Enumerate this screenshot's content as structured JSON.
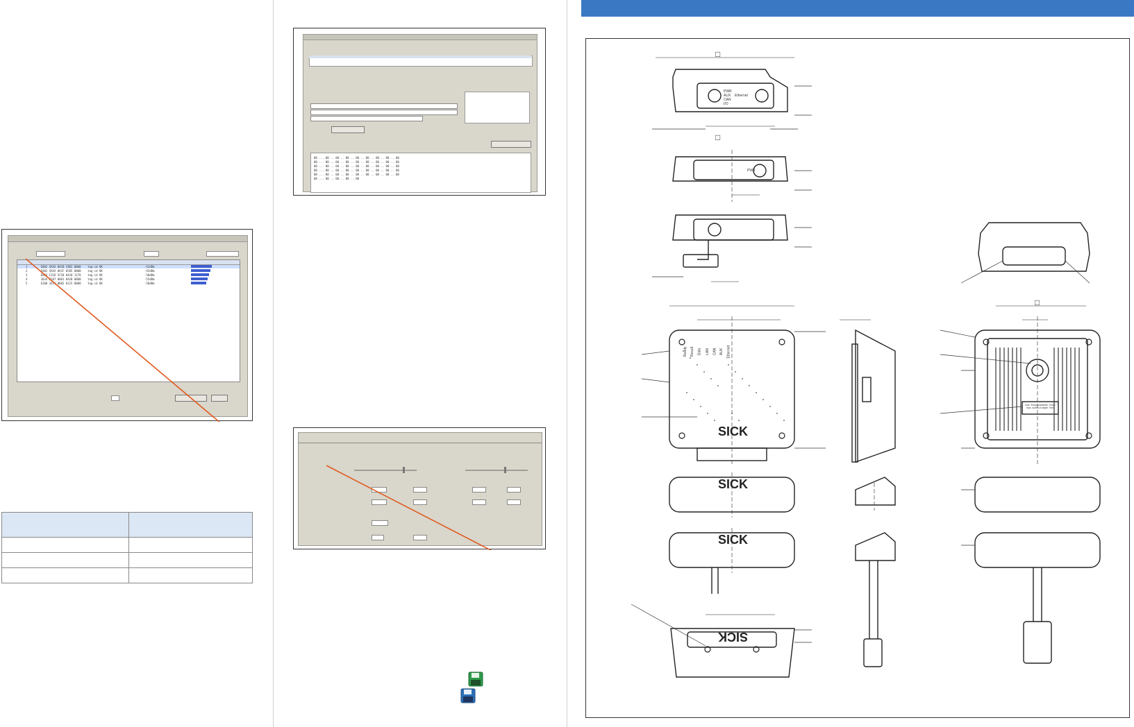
{
  "colors": {
    "accent_bar": "#3a78c4",
    "callout_line": "#e05a1f",
    "table_header": "#dce7f5",
    "save_icon_green": "#2e9b4a",
    "save_icon_blue": "#2b6fb6"
  },
  "logo": {
    "text": "SICK"
  },
  "drawing": {
    "symbol": "□",
    "front_labels": [
      "PWR",
      "AUX",
      "CAN",
      "I/O"
    ],
    "front_label_right": "Ethernet",
    "side_label": "PWR",
    "led_labels": [
      "Ready",
      "Result",
      "Data",
      "LAN",
      "CAN",
      "AUX",
      "Ethernet"
    ],
    "back_label": "max. Einschraubtiefe 7mm / max. screw-in depth 7mm"
  },
  "icons": {
    "save": "floppy-disk-icon",
    "save_as": "floppy-disk-icon"
  }
}
